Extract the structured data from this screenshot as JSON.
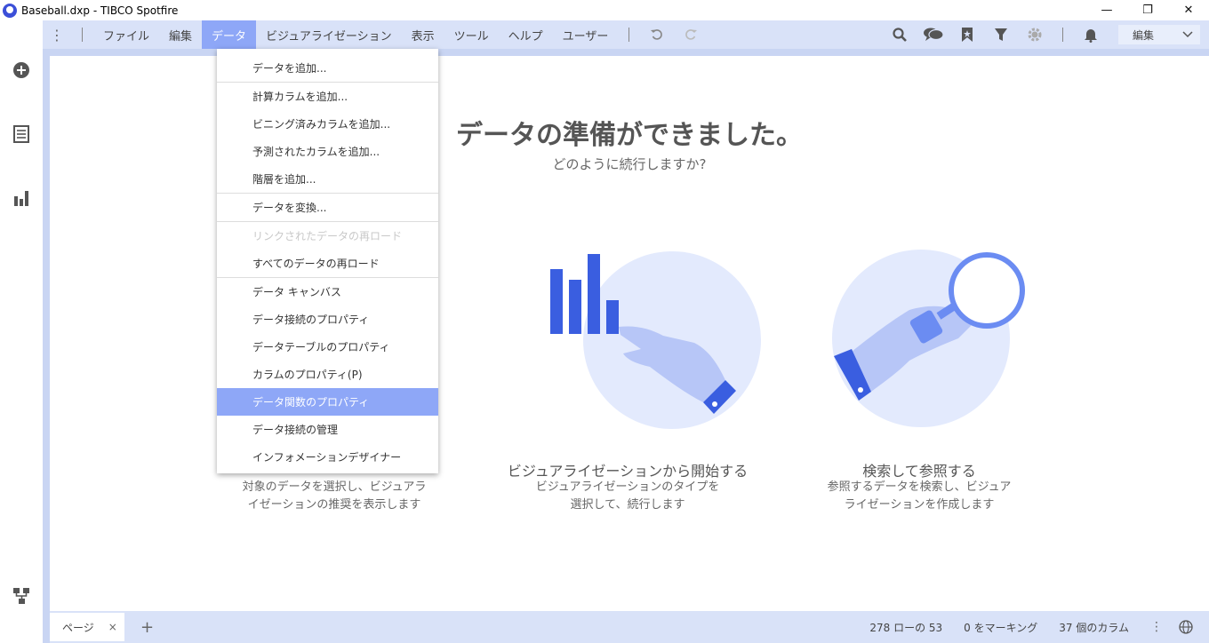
{
  "window": {
    "title": "Baseball.dxp - TIBCO Spotfire",
    "minimize": "—",
    "restore": "❐",
    "close": "✕"
  },
  "menubar": {
    "items": [
      {
        "label": "ファイル"
      },
      {
        "label": "編集"
      },
      {
        "label": "データ"
      },
      {
        "label": "ビジュアライゼーション"
      },
      {
        "label": "表示"
      },
      {
        "label": "ツール"
      },
      {
        "label": "ヘルプ"
      },
      {
        "label": "ユーザー"
      }
    ],
    "active_index": 2,
    "mode_select": "編集"
  },
  "data_menu": {
    "items": [
      {
        "label": "データを追加..."
      },
      {
        "label": "計算カラムを追加..."
      },
      {
        "label": "ビニング済みカラムを追加..."
      },
      {
        "label": "予測されたカラムを追加..."
      },
      {
        "label": "階層を追加..."
      },
      {
        "label": "データを変換..."
      },
      {
        "label": "リンクされたデータの再ロード"
      },
      {
        "label": "すべてのデータの再ロード"
      },
      {
        "label": "データ キャンバス"
      },
      {
        "label": "データ接続のプロパティ"
      },
      {
        "label": "データテーブルのプロパティ"
      },
      {
        "label": "カラムのプロパティ(P)"
      },
      {
        "label": "データ関数のプロパティ"
      },
      {
        "label": "データ接続の管理"
      },
      {
        "label": "インフォメーションデザイナー"
      }
    ]
  },
  "welcome": {
    "title": "データの準備ができました。",
    "subtitle": "どのように続行しますか?",
    "cards": [
      {
        "title": "",
        "desc1": "対象のデータを選択し、ビジュアラ",
        "desc2": "イゼーションの推奨を表示します"
      },
      {
        "title": "ビジュアライゼーションから開始する",
        "desc1": "ビジュアライゼーションのタイプを",
        "desc2": "選択して、続行します"
      },
      {
        "title": "検索して参照する",
        "desc1": "参照するデータを検索し、ビジュア",
        "desc2": "ライゼーションを作成します"
      }
    ]
  },
  "statusbar": {
    "page_tab": "ページ",
    "close_tab": "×",
    "add_page": "+",
    "rows": "278 ローの 53",
    "marked": "0 をマーキング",
    "columns": "37 個のカラム",
    "more": "⋮"
  },
  "colors": {
    "accent": "#8ea7f7",
    "menubar_bg": "#d9e2f8",
    "illustration_blue": "#3a5ee0"
  },
  "icons": {
    "undo": "undo-icon",
    "redo": "redo-icon",
    "search": "search-icon",
    "comments": "comments-icon",
    "bookmark": "bookmark-icon",
    "filter": "filter-icon",
    "settings": "gear-icon",
    "notifications": "bell-icon"
  }
}
